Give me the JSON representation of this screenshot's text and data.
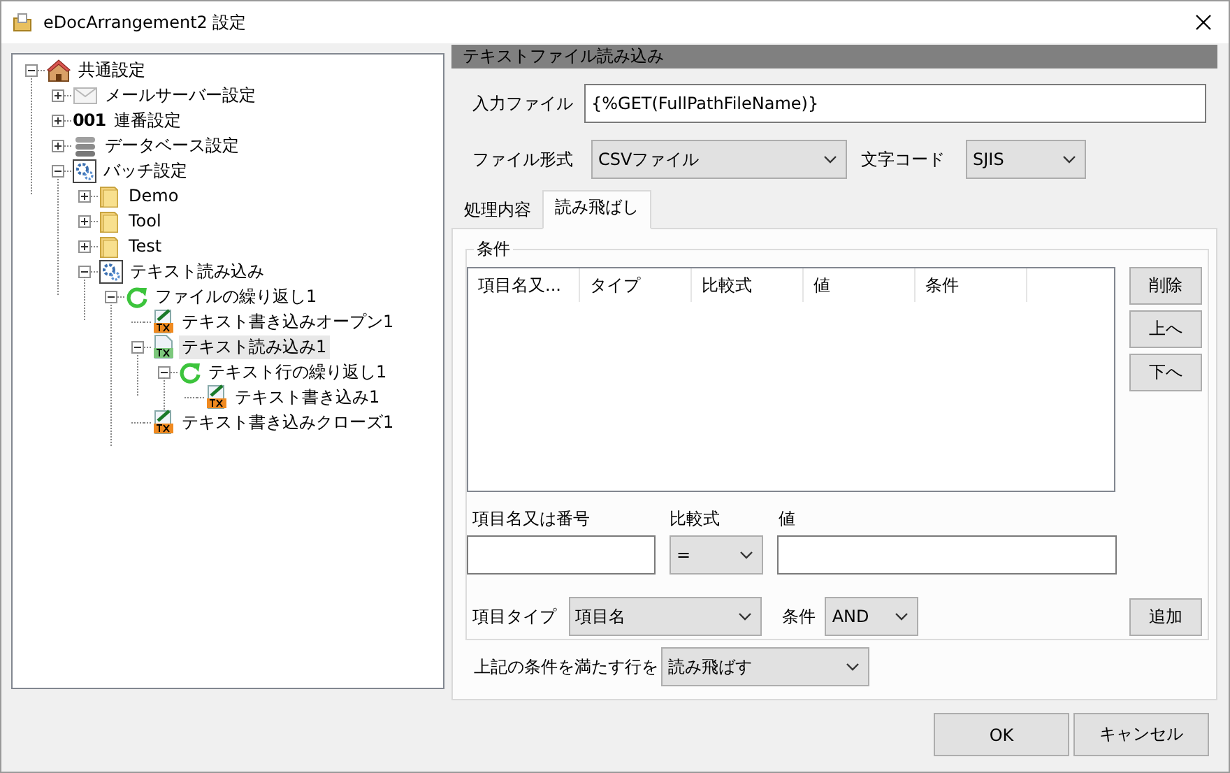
{
  "window": {
    "title": "eDocArrangement2 設定"
  },
  "tree": [
    {
      "label": "共通設定",
      "kind": "house",
      "expanded": true,
      "selected": false,
      "children": [
        {
          "label": "メールサーバー設定",
          "kind": "mail",
          "expanded": false,
          "selected": false
        },
        {
          "label": "連番設定",
          "kind": "counter",
          "icon_text": "001",
          "expanded": false,
          "selected": false
        },
        {
          "label": "データベース設定",
          "kind": "database",
          "expanded": false,
          "selected": false
        },
        {
          "label": "バッチ設定",
          "kind": "batch",
          "expanded": true,
          "selected": false,
          "children": [
            {
              "label": "Demo",
              "kind": "folder",
              "expanded": false,
              "selected": false
            },
            {
              "label": "Tool",
              "kind": "folder",
              "expanded": false,
              "selected": false
            },
            {
              "label": "Test",
              "kind": "folder",
              "expanded": false,
              "selected": false
            },
            {
              "label": "テキスト読み込み",
              "kind": "batch",
              "expanded": true,
              "selected": false,
              "children": [
                {
                  "label": "ファイルの繰り返し1",
                  "kind": "loop",
                  "expanded": true,
                  "selected": false,
                  "children": [
                    {
                      "label": "テキスト書き込みオープン1",
                      "kind": "txtwrite",
                      "selected": false
                    },
                    {
                      "label": "テキスト読み込み1",
                      "kind": "txtread",
                      "expanded": true,
                      "selected": true,
                      "children": [
                        {
                          "label": "テキスト行の繰り返し1",
                          "kind": "loop",
                          "expanded": true,
                          "selected": false,
                          "children": [
                            {
                              "label": "テキスト書き込み1",
                              "kind": "txtwrite",
                              "selected": false
                            }
                          ]
                        }
                      ]
                    },
                    {
                      "label": "テキスト書き込みクローズ1",
                      "kind": "txtwrite",
                      "selected": false
                    }
                  ]
                }
              ]
            }
          ]
        }
      ]
    }
  ],
  "section_title": "テキストファイル読み込み",
  "input_file": {
    "label": "入力ファイル",
    "value": "{%GET(FullPathFileName)}"
  },
  "file_format": {
    "label": "ファイル形式",
    "value": "CSVファイル"
  },
  "encoding": {
    "label": "文字コード",
    "value": "SJIS"
  },
  "tabs": [
    {
      "label": "処理内容",
      "selected": false
    },
    {
      "label": "読み飛ばし",
      "selected": true
    }
  ],
  "conditions": {
    "title": "条件",
    "columns": [
      "項目名又...",
      "タイプ",
      "比較式",
      "値",
      "条件"
    ],
    "buttons": [
      "削除",
      "上へ",
      "下へ"
    ],
    "item_field": {
      "label": "項目名又は番号"
    },
    "operator": {
      "label": "比較式",
      "value": "="
    },
    "value_field": {
      "label": "値"
    },
    "item_type": {
      "label": "項目タイプ",
      "value": "項目名"
    },
    "logic": {
      "label": "条件",
      "value": "AND"
    },
    "add_button": "追加"
  },
  "action": {
    "label": "上記の条件を満たす行を",
    "value": "読み飛ばす"
  },
  "buttons": [
    "OK",
    "キャンセル"
  ]
}
